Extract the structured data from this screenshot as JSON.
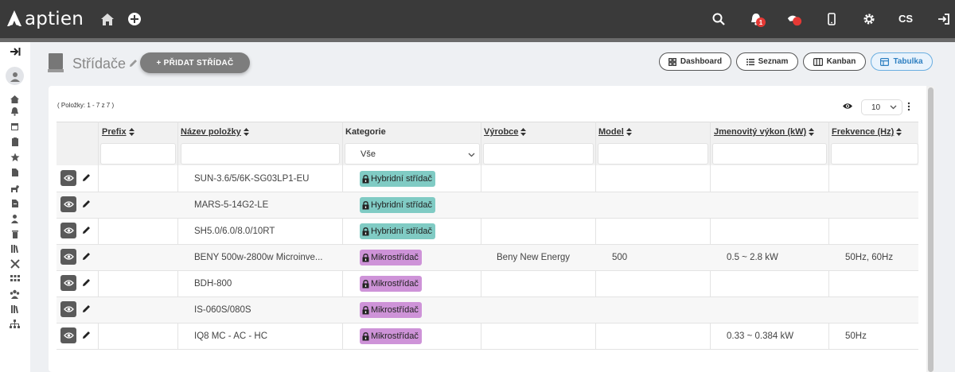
{
  "app": {
    "logo_text": "aptien",
    "language": "CS",
    "notification_count": "1"
  },
  "page": {
    "title": "Střídače",
    "add_button": "+ PŘIDAT STŘÍDAČ",
    "views": [
      {
        "label": "Dashboard",
        "icon": "dashboard-icon"
      },
      {
        "label": "Seznam",
        "icon": "list-icon"
      },
      {
        "label": "Kanban",
        "icon": "kanban-icon"
      },
      {
        "label": "Tabulka",
        "icon": "table-icon",
        "active": true
      }
    ],
    "items_count": "( Položky: 1 - 7 z 7 )",
    "page_size": "10"
  },
  "table": {
    "columns": [
      {
        "key": "prefix",
        "label": "Prefix",
        "sortable": true
      },
      {
        "key": "name",
        "label": "Název položky",
        "sortable": true
      },
      {
        "key": "category",
        "label": "Kategorie",
        "sortable": false
      },
      {
        "key": "manufacturer",
        "label": "Výrobce",
        "sortable": true
      },
      {
        "key": "model",
        "label": "Model",
        "sortable": true
      },
      {
        "key": "power",
        "label": "Jmenovitý výkon (kW)",
        "sortable": true
      },
      {
        "key": "frequency",
        "label": "Frekvence (Hz)",
        "sortable": true
      }
    ],
    "category_filter": "Vše",
    "rows": [
      {
        "prefix": "",
        "name": "SUN-3.6/5/6K-SG03LP1-EU",
        "category": "Hybridní střídač",
        "category_type": "hyb",
        "manufacturer": "",
        "model": "",
        "power": "",
        "frequency": ""
      },
      {
        "prefix": "",
        "name": "MARS-5-14G2-LE",
        "category": "Hybridní střídač",
        "category_type": "hyb",
        "manufacturer": "",
        "model": "",
        "power": "",
        "frequency": ""
      },
      {
        "prefix": "",
        "name": "SH5.0/6.0/8.0/10RT",
        "category": "Hybridní střídač",
        "category_type": "hyb",
        "manufacturer": "",
        "model": "",
        "power": "",
        "frequency": ""
      },
      {
        "prefix": "",
        "name": "BENY 500w-2800w Microinve...",
        "category": "Mikrostřídač",
        "category_type": "mik",
        "manufacturer": "Beny New Energy",
        "model": "500",
        "power": "0.5 ~ 2.8 kW",
        "frequency": "50Hz, 60Hz"
      },
      {
        "prefix": "",
        "name": "BDH-800",
        "category": "Mikrostřídač",
        "category_type": "mik",
        "manufacturer": "",
        "model": "",
        "power": "",
        "frequency": ""
      },
      {
        "prefix": "",
        "name": "IS-060S/080S",
        "category": "Mikrostřídač",
        "category_type": "mik",
        "manufacturer": "",
        "model": "",
        "power": "",
        "frequency": ""
      },
      {
        "prefix": "",
        "name": "IQ8 MC - AC - HC",
        "category": "Mikrostřídač",
        "category_type": "mik",
        "manufacturer": "",
        "model": "",
        "power": "0.33 ~ 0.384 kW",
        "frequency": "50Hz"
      }
    ]
  },
  "colors": {
    "topbar": "#3a3a3a",
    "hybrid_tag": "#80cbc4",
    "micro_tag": "#ce93d8",
    "active_view": "#2d7fc1"
  }
}
